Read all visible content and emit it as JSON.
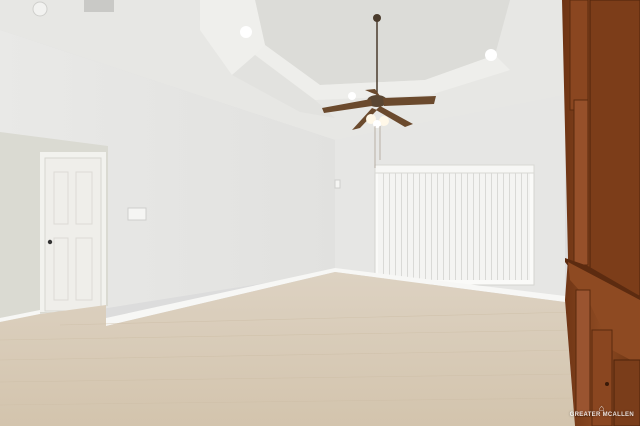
{
  "scene": {
    "description_type": "empty room interior photo",
    "watermark": "GREATER MCALLEN"
  },
  "colors": {
    "wall": "#ececea",
    "ceiling": "#e6e6e3",
    "floor": "#d8cbb8",
    "cabinet": "#7a3e1a",
    "blinds": "#f3f3f1"
  }
}
